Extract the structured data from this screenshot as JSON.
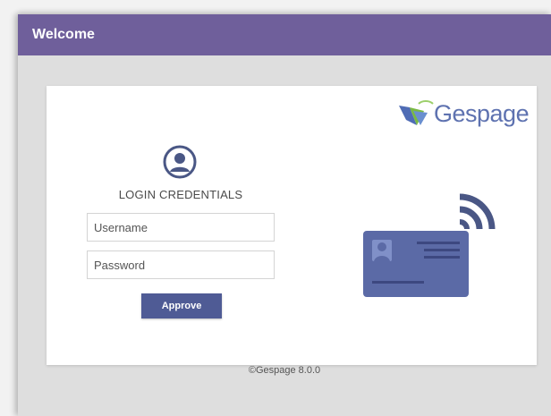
{
  "window": {
    "title": "Welcome"
  },
  "logo": {
    "text": "Gespage",
    "icon": "gespage-leaf-logo-icon"
  },
  "login": {
    "icon": "user-circle-icon",
    "heading": "LOGIN CREDENTIALS",
    "username_placeholder": "Username",
    "username_value": "",
    "password_placeholder": "Password",
    "password_value": "",
    "approve_label": "Approve"
  },
  "illustration": {
    "icon": "contactless-id-card-icon"
  },
  "footer": {
    "copyright": "©Gespage 8.0.0"
  },
  "colors": {
    "titlebar": "#6f5f9b",
    "button": "#4f5b95",
    "card_illustration": "#5b6aa6",
    "user_icon": "#4a5785",
    "logo_text": "#5e72b0",
    "logo_leaf": "#4f6cb5",
    "logo_leaf_accent": "#79b943"
  }
}
